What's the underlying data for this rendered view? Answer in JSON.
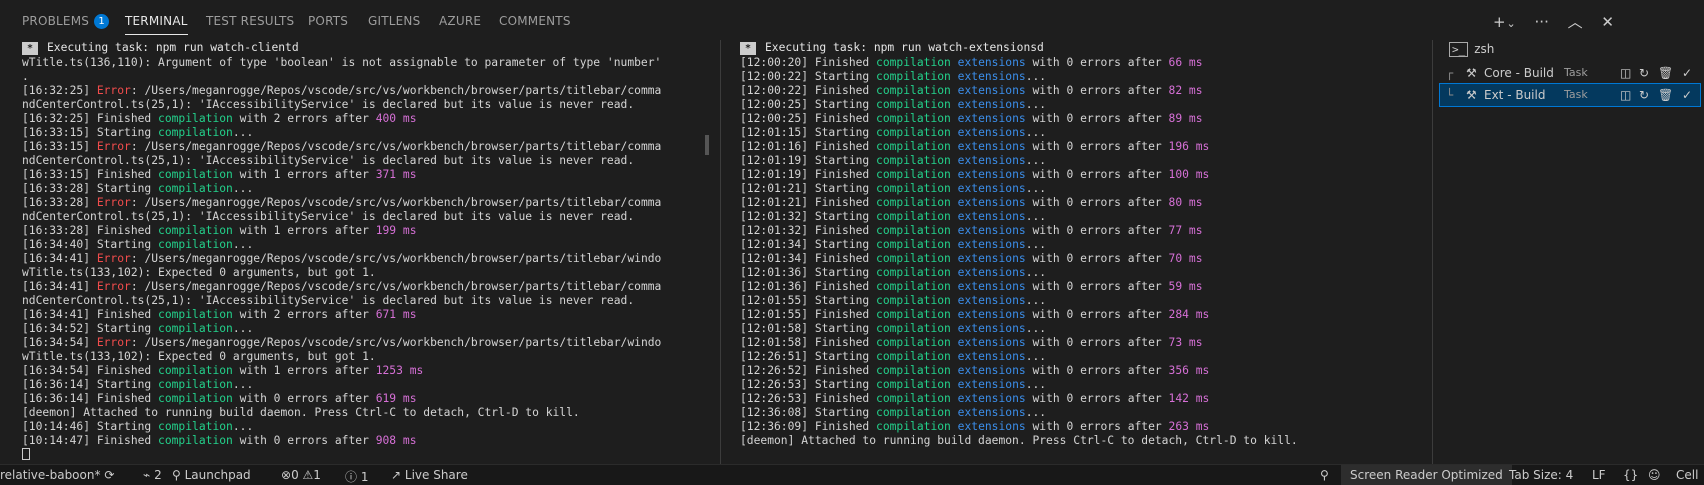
{
  "tabs": {
    "problems": "PROBLEMS",
    "problems_count": "1",
    "terminal": "TERMINAL",
    "test_results": "TEST RESULTS",
    "ports": "PORTS",
    "gitlens": "GITLENS",
    "azure": "AZURE",
    "comments": "COMMENTS"
  },
  "icons": {
    "plus": "+",
    "chevron": "⌄",
    "ellipsis": "···",
    "chevron_up": "︿",
    "close": "✕"
  },
  "pane1": {
    "header_star": "*",
    "header": "Executing task: npm run watch-clientd",
    "lines": [
      [
        [
          "t",
          "wTitle.ts(136,110): Argument of type 'boolean' is not assignable to parameter of type 'number'"
        ]
      ],
      [
        [
          "t",
          "."
        ]
      ],
      [
        [
          "t",
          "[16:32:25] "
        ],
        [
          "err",
          "Error"
        ],
        [
          "t",
          ": /Users/meganrogge/Repos/vscode/src/vs/workbench/browser/parts/titlebar/comma"
        ]
      ],
      [
        [
          "t",
          "ndCenterControl.ts(25,1): 'IAccessibilityService' is declared but its value is never read."
        ]
      ],
      [
        [
          "t",
          "[16:32:25] Finished "
        ],
        [
          "grn",
          "compilation"
        ],
        [
          "t",
          " with 2 errors after "
        ],
        [
          "mag",
          "400 ms"
        ]
      ],
      [
        [
          "t",
          "[16:33:15] Starting "
        ],
        [
          "grn",
          "compilation"
        ],
        [
          "t",
          "..."
        ]
      ],
      [
        [
          "t",
          "[16:33:15] "
        ],
        [
          "err",
          "Error"
        ],
        [
          "t",
          ": /Users/meganrogge/Repos/vscode/src/vs/workbench/browser/parts/titlebar/comma"
        ]
      ],
      [
        [
          "t",
          "ndCenterControl.ts(25,1): 'IAccessibilityService' is declared but its value is never read."
        ]
      ],
      [
        [
          "t",
          "[16:33:15] Finished "
        ],
        [
          "grn",
          "compilation"
        ],
        [
          "t",
          " with 1 errors after "
        ],
        [
          "mag",
          "371 ms"
        ]
      ],
      [
        [
          "t",
          "[16:33:28] Starting "
        ],
        [
          "grn",
          "compilation"
        ],
        [
          "t",
          "..."
        ]
      ],
      [
        [
          "t",
          "[16:33:28] "
        ],
        [
          "err",
          "Error"
        ],
        [
          "t",
          ": /Users/meganrogge/Repos/vscode/src/vs/workbench/browser/parts/titlebar/comma"
        ]
      ],
      [
        [
          "t",
          "ndCenterControl.ts(25,1): 'IAccessibilityService' is declared but its value is never read."
        ]
      ],
      [
        [
          "t",
          "[16:33:28] Finished "
        ],
        [
          "grn",
          "compilation"
        ],
        [
          "t",
          " with 1 errors after "
        ],
        [
          "mag",
          "199 ms"
        ]
      ],
      [
        [
          "t",
          "[16:34:40] Starting "
        ],
        [
          "grn",
          "compilation"
        ],
        [
          "t",
          "..."
        ]
      ],
      [
        [
          "t",
          "[16:34:41] "
        ],
        [
          "err",
          "Error"
        ],
        [
          "t",
          ": /Users/meganrogge/Repos/vscode/src/vs/workbench/browser/parts/titlebar/windo"
        ]
      ],
      [
        [
          "t",
          "wTitle.ts(133,102): Expected 0 arguments, but got 1."
        ]
      ],
      [
        [
          "t",
          "[16:34:41] "
        ],
        [
          "err",
          "Error"
        ],
        [
          "t",
          ": /Users/meganrogge/Repos/vscode/src/vs/workbench/browser/parts/titlebar/comma"
        ]
      ],
      [
        [
          "t",
          "ndCenterControl.ts(25,1): 'IAccessibilityService' is declared but its value is never read."
        ]
      ],
      [
        [
          "t",
          "[16:34:41] Finished "
        ],
        [
          "grn",
          "compilation"
        ],
        [
          "t",
          " with 2 errors after "
        ],
        [
          "mag",
          "671 ms"
        ]
      ],
      [
        [
          "t",
          "[16:34:52] Starting "
        ],
        [
          "grn",
          "compilation"
        ],
        [
          "t",
          "..."
        ]
      ],
      [
        [
          "t",
          "[16:34:54] "
        ],
        [
          "err",
          "Error"
        ],
        [
          "t",
          ": /Users/meganrogge/Repos/vscode/src/vs/workbench/browser/parts/titlebar/windo"
        ]
      ],
      [
        [
          "t",
          "wTitle.ts(133,102): Expected 0 arguments, but got 1."
        ]
      ],
      [
        [
          "t",
          "[16:34:54] Finished "
        ],
        [
          "grn",
          "compilation"
        ],
        [
          "t",
          " with 1 errors after "
        ],
        [
          "mag",
          "1253 ms"
        ]
      ],
      [
        [
          "t",
          "[16:36:14] Starting "
        ],
        [
          "grn",
          "compilation"
        ],
        [
          "t",
          "..."
        ]
      ],
      [
        [
          "t",
          "[16:36:14] Finished "
        ],
        [
          "grn",
          "compilation"
        ],
        [
          "t",
          " with 0 errors after "
        ],
        [
          "mag",
          "619 ms"
        ]
      ],
      [
        [
          "t",
          "[deemon] Attached to running build daemon. Press Ctrl-C to detach, Ctrl-D to kill."
        ]
      ],
      [
        [
          "t",
          "[10:14:46] Starting "
        ],
        [
          "grn",
          "compilation"
        ],
        [
          "t",
          "..."
        ]
      ],
      [
        [
          "t",
          "[10:14:47] Finished "
        ],
        [
          "grn",
          "compilation"
        ],
        [
          "t",
          " with 0 errors after "
        ],
        [
          "mag",
          "908 ms"
        ]
      ]
    ]
  },
  "pane2": {
    "header_star": "*",
    "header": "Executing task: npm run watch-extensionsd",
    "lines": [
      [
        [
          "t",
          "[12:00:20] Finished "
        ],
        [
          "grn",
          "compilation"
        ],
        [
          "t",
          " "
        ],
        [
          "blu",
          "extensions"
        ],
        [
          "t",
          " with 0 errors after "
        ],
        [
          "mag",
          "66 ms"
        ]
      ],
      [
        [
          "t",
          "[12:00:22] Starting "
        ],
        [
          "grn",
          "compilation"
        ],
        [
          "t",
          " "
        ],
        [
          "blu",
          "extensions"
        ],
        [
          "t",
          "..."
        ]
      ],
      [
        [
          "t",
          "[12:00:22] Finished "
        ],
        [
          "grn",
          "compilation"
        ],
        [
          "t",
          " "
        ],
        [
          "blu",
          "extensions"
        ],
        [
          "t",
          " with 0 errors after "
        ],
        [
          "mag",
          "82 ms"
        ]
      ],
      [
        [
          "t",
          "[12:00:25] Starting "
        ],
        [
          "grn",
          "compilation"
        ],
        [
          "t",
          " "
        ],
        [
          "blu",
          "extensions"
        ],
        [
          "t",
          "..."
        ]
      ],
      [
        [
          "t",
          "[12:00:25] Finished "
        ],
        [
          "grn",
          "compilation"
        ],
        [
          "t",
          " "
        ],
        [
          "blu",
          "extensions"
        ],
        [
          "t",
          " with 0 errors after "
        ],
        [
          "mag",
          "89 ms"
        ]
      ],
      [
        [
          "t",
          "[12:01:15] Starting "
        ],
        [
          "grn",
          "compilation"
        ],
        [
          "t",
          " "
        ],
        [
          "blu",
          "extensions"
        ],
        [
          "t",
          "..."
        ]
      ],
      [
        [
          "t",
          "[12:01:16] Finished "
        ],
        [
          "grn",
          "compilation"
        ],
        [
          "t",
          " "
        ],
        [
          "blu",
          "extensions"
        ],
        [
          "t",
          " with 0 errors after "
        ],
        [
          "mag",
          "196 ms"
        ]
      ],
      [
        [
          "t",
          "[12:01:19] Starting "
        ],
        [
          "grn",
          "compilation"
        ],
        [
          "t",
          " "
        ],
        [
          "blu",
          "extensions"
        ],
        [
          "t",
          "..."
        ]
      ],
      [
        [
          "t",
          "[12:01:19] Finished "
        ],
        [
          "grn",
          "compilation"
        ],
        [
          "t",
          " "
        ],
        [
          "blu",
          "extensions"
        ],
        [
          "t",
          " with 0 errors after "
        ],
        [
          "mag",
          "100 ms"
        ]
      ],
      [
        [
          "t",
          "[12:01:21] Starting "
        ],
        [
          "grn",
          "compilation"
        ],
        [
          "t",
          " "
        ],
        [
          "blu",
          "extensions"
        ],
        [
          "t",
          "..."
        ]
      ],
      [
        [
          "t",
          "[12:01:21] Finished "
        ],
        [
          "grn",
          "compilation"
        ],
        [
          "t",
          " "
        ],
        [
          "blu",
          "extensions"
        ],
        [
          "t",
          " with 0 errors after "
        ],
        [
          "mag",
          "80 ms"
        ]
      ],
      [
        [
          "t",
          "[12:01:32] Starting "
        ],
        [
          "grn",
          "compilation"
        ],
        [
          "t",
          " "
        ],
        [
          "blu",
          "extensions"
        ],
        [
          "t",
          "..."
        ]
      ],
      [
        [
          "t",
          "[12:01:32] Finished "
        ],
        [
          "grn",
          "compilation"
        ],
        [
          "t",
          " "
        ],
        [
          "blu",
          "extensions"
        ],
        [
          "t",
          " with 0 errors after "
        ],
        [
          "mag",
          "77 ms"
        ]
      ],
      [
        [
          "t",
          "[12:01:34] Starting "
        ],
        [
          "grn",
          "compilation"
        ],
        [
          "t",
          " "
        ],
        [
          "blu",
          "extensions"
        ],
        [
          "t",
          "..."
        ]
      ],
      [
        [
          "t",
          "[12:01:34] Finished "
        ],
        [
          "grn",
          "compilation"
        ],
        [
          "t",
          " "
        ],
        [
          "blu",
          "extensions"
        ],
        [
          "t",
          " with 0 errors after "
        ],
        [
          "mag",
          "70 ms"
        ]
      ],
      [
        [
          "t",
          "[12:01:36] Starting "
        ],
        [
          "grn",
          "compilation"
        ],
        [
          "t",
          " "
        ],
        [
          "blu",
          "extensions"
        ],
        [
          "t",
          "..."
        ]
      ],
      [
        [
          "t",
          "[12:01:36] Finished "
        ],
        [
          "grn",
          "compilation"
        ],
        [
          "t",
          " "
        ],
        [
          "blu",
          "extensions"
        ],
        [
          "t",
          " with 0 errors after "
        ],
        [
          "mag",
          "59 ms"
        ]
      ],
      [
        [
          "t",
          "[12:01:55] Starting "
        ],
        [
          "grn",
          "compilation"
        ],
        [
          "t",
          " "
        ],
        [
          "blu",
          "extensions"
        ],
        [
          "t",
          "..."
        ]
      ],
      [
        [
          "t",
          "[12:01:55] Finished "
        ],
        [
          "grn",
          "compilation"
        ],
        [
          "t",
          " "
        ],
        [
          "blu",
          "extensions"
        ],
        [
          "t",
          " with 0 errors after "
        ],
        [
          "mag",
          "284 ms"
        ]
      ],
      [
        [
          "t",
          "[12:01:58] Starting "
        ],
        [
          "grn",
          "compilation"
        ],
        [
          "t",
          " "
        ],
        [
          "blu",
          "extensions"
        ],
        [
          "t",
          "..."
        ]
      ],
      [
        [
          "t",
          "[12:01:58] Finished "
        ],
        [
          "grn",
          "compilation"
        ],
        [
          "t",
          " "
        ],
        [
          "blu",
          "extensions"
        ],
        [
          "t",
          " with 0 errors after "
        ],
        [
          "mag",
          "73 ms"
        ]
      ],
      [
        [
          "t",
          "[12:26:51] Starting "
        ],
        [
          "grn",
          "compilation"
        ],
        [
          "t",
          " "
        ],
        [
          "blu",
          "extensions"
        ],
        [
          "t",
          "..."
        ]
      ],
      [
        [
          "t",
          "[12:26:52] Finished "
        ],
        [
          "grn",
          "compilation"
        ],
        [
          "t",
          " "
        ],
        [
          "blu",
          "extensions"
        ],
        [
          "t",
          " with 0 errors after "
        ],
        [
          "mag",
          "356 ms"
        ]
      ],
      [
        [
          "t",
          "[12:26:53] Starting "
        ],
        [
          "grn",
          "compilation"
        ],
        [
          "t",
          " "
        ],
        [
          "blu",
          "extensions"
        ],
        [
          "t",
          "..."
        ]
      ],
      [
        [
          "t",
          "[12:26:53] Finished "
        ],
        [
          "grn",
          "compilation"
        ],
        [
          "t",
          " "
        ],
        [
          "blu",
          "extensions"
        ],
        [
          "t",
          " with 0 errors after "
        ],
        [
          "mag",
          "142 ms"
        ]
      ],
      [
        [
          "t",
          "[12:36:08] Starting "
        ],
        [
          "grn",
          "compilation"
        ],
        [
          "t",
          " "
        ],
        [
          "blu",
          "extensions"
        ],
        [
          "t",
          "..."
        ]
      ],
      [
        [
          "t",
          "[12:36:09] Finished "
        ],
        [
          "grn",
          "compilation"
        ],
        [
          "t",
          " "
        ],
        [
          "blu",
          "extensions"
        ],
        [
          "t",
          " with 0 errors after "
        ],
        [
          "mag",
          "263 ms"
        ]
      ],
      [
        [
          "t",
          "[deemon] Attached to running build daemon. Press Ctrl-C to detach, Ctrl-D to kill."
        ]
      ]
    ]
  },
  "terminal_list": {
    "shell": "zsh",
    "items": [
      {
        "name": "Core - Build",
        "kind": "Task"
      },
      {
        "name": "Ext - Build",
        "kind": "Task"
      }
    ]
  },
  "statusbar": {
    "branch": "relative-baboon*",
    "ports": "2",
    "launchpad": "Launchpad",
    "errors": "0",
    "warnings": "1",
    "info": "1",
    "live_share": "Live Share",
    "screen_reader": "Screen Reader Optimized",
    "tab_size": "Tab Size: 4",
    "eol": "LF",
    "braces": "{}",
    "cell": "Cell"
  },
  "colors": {
    "accent": "#0078d4",
    "error": "#f14c4c",
    "compilation": "#23d18b",
    "extensions": "#3b8eea",
    "timing": "#d670d6"
  }
}
